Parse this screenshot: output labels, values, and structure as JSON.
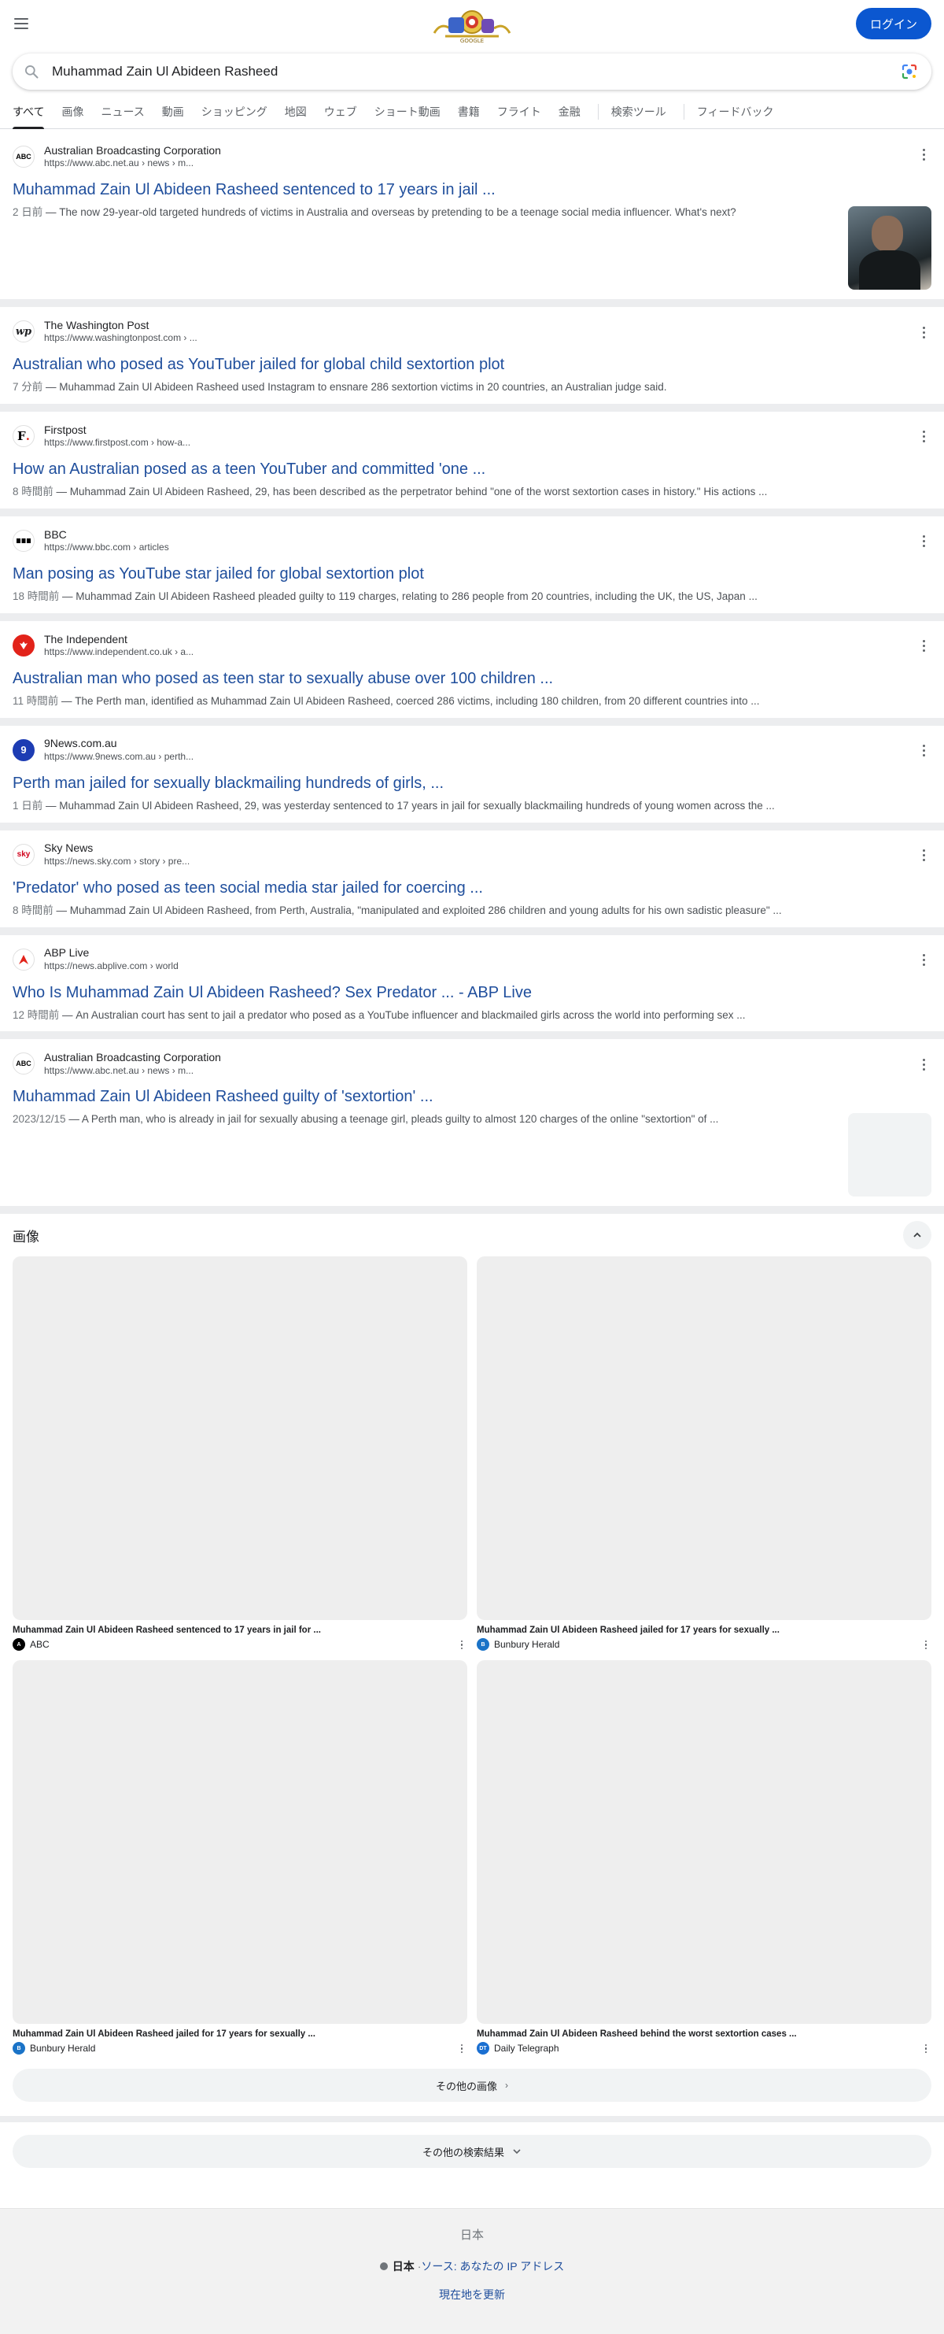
{
  "header": {
    "logo_alt": "Google Doodle",
    "login_label": "ログイン"
  },
  "search": {
    "query": "Muhammad Zain Ul Abideen Rasheed"
  },
  "tabs": [
    {
      "label": "すべて",
      "active": true
    },
    {
      "label": "画像"
    },
    {
      "label": "ニュース"
    },
    {
      "label": "動画"
    },
    {
      "label": "ショッピング"
    },
    {
      "label": "地図"
    },
    {
      "label": "ウェブ"
    },
    {
      "label": "ショート動画"
    },
    {
      "label": "書籍"
    },
    {
      "label": "フライト"
    },
    {
      "label": "金融"
    },
    {
      "label": "検索ツール"
    },
    {
      "label": "フィードバック"
    }
  ],
  "results": [
    {
      "source": "Australian Broadcasting Corporation",
      "url": "https://www.abc.net.au › news › m...",
      "title": "Muhammad Zain Ul Abideen Rasheed sentenced to 17 years in jail ...",
      "date": "2 日前",
      "snippet": "The now 29-year-old targeted hundreds of victims in Australia and overseas by pretending to be a teenage social media influencer. What's next?",
      "favicon": "ABC",
      "favicon_color": "#000000",
      "thumb": "photo"
    },
    {
      "source": "The Washington Post",
      "url": "https://www.washingtonpost.com › ...",
      "title": "Australian who posed as YouTuber jailed for global child sextortion plot",
      "date": "7 分前",
      "snippet": "Muhammad Zain Ul Abideen Rasheed used Instagram to ensnare 286 sextortion victims in 20 countries, an Australian judge said.",
      "favicon": "wp",
      "favicon_color": "#000000"
    },
    {
      "source": "Firstpost",
      "url": "https://www.firstpost.com › how-a...",
      "title": "How an Australian posed as a teen YouTuber and committed 'one ...",
      "date": "8 時間前",
      "snippet": "Muhammad Zain Ul Abideen Rasheed, 29, has been described as the perpetrator behind \"one of the worst sextortion cases in history.\" His actions ...",
      "favicon": "F.",
      "favicon_color": "#000000"
    },
    {
      "source": "BBC",
      "url": "https://www.bbc.com › articles",
      "title": "Man posing as YouTube star jailed for global sextortion plot",
      "date": "18 時間前",
      "snippet": "Muhammad Zain Ul Abideen Rasheed pleaded guilty to 119 charges, relating to 286 people from 20 countries, including the UK, the US, Japan ...",
      "favicon": "BBC",
      "favicon_color": "#000000"
    },
    {
      "source": "The Independent",
      "url": "https://www.independent.co.uk › a...",
      "title": "Australian man who posed as teen star to sexually abuse over 100 children ...",
      "date": "11 時間前",
      "snippet": "The Perth man, identified as Muhammad Zain Ul Abideen Rasheed, coerced 286 victims, including 180 children, from 20 different countries into ...",
      "favicon": "",
      "favicon_color": "#e2231a"
    },
    {
      "source": "9News.com.au",
      "url": "https://www.9news.com.au › perth...",
      "title": "Perth man jailed for sexually blackmailing hundreds of girls, ...",
      "date": "1 日前",
      "snippet": "Muhammad Zain Ul Abideen Rasheed, 29, was yesterday sentenced to 17 years in jail for sexually blackmailing hundreds of young women across the ...",
      "favicon": "9",
      "favicon_color": "#1d3cb3"
    },
    {
      "source": "Sky News",
      "url": "https://news.sky.com › story › pre...",
      "title": "'Predator' who posed as teen social media star jailed for coercing ...",
      "date": "8 時間前",
      "snippet": "Muhammad Zain Ul Abideen Rasheed, from Perth, Australia, \"manipulated and exploited 286 children and young adults for his own sadistic pleasure\" ...",
      "favicon": "sky",
      "favicon_color": "#d0021b"
    },
    {
      "source": "ABP Live",
      "url": "https://news.abplive.com › world",
      "title": "Who Is Muhammad Zain Ul Abideen Rasheed? Sex Predator ... - ABP Live",
      "date": "12 時間前",
      "snippet": "An Australian court has sent to jail a predator who posed as a YouTube influencer and blackmailed girls across the world into performing sex ...",
      "favicon": "▲",
      "favicon_color": "#e2231a"
    },
    {
      "source": "Australian Broadcasting Corporation",
      "url": "https://www.abc.net.au › news › m...",
      "title": "Muhammad Zain Ul Abideen Rasheed guilty of 'sextortion' ...",
      "date": "2023/12/15",
      "snippet": "A Perth man, who is already in jail for sexually abusing a teenage girl, pleads guilty to almost 120 charges of the online \"sextortion\" of ...",
      "favicon": "ABC",
      "favicon_color": "#000000",
      "thumb": "blank"
    }
  ],
  "images": {
    "heading": "画像",
    "items": [
      {
        "caption": "Muhammad Zain Ul Abideen Rasheed sentenced to 17 years in jail for ...",
        "source": "ABC",
        "favicon_color": "#000000"
      },
      {
        "caption": "Muhammad Zain Ul Abideen Rasheed jailed for 17 years for sexually ...",
        "source": "Bunbury Herald",
        "favicon_color": "#1a73c7"
      },
      {
        "caption": "Muhammad Zain Ul Abideen Rasheed jailed for 17 years for sexually ...",
        "source": "Bunbury Herald",
        "favicon_color": "#1a73c7"
      },
      {
        "caption": "Muhammad Zain Ul Abideen Rasheed behind the worst sextortion cases ...",
        "source": "Daily Telegraph",
        "favicon_color": "#1a6fd1"
      }
    ],
    "more_label": "その他の画像"
  },
  "more_results_label": "その他の検索結果",
  "footer": {
    "country": "日本",
    "location_name": "日本",
    "location_sep": " · ",
    "location_source": "ソース: あなたの IP アドレス",
    "update_location": "現在地を更新"
  }
}
